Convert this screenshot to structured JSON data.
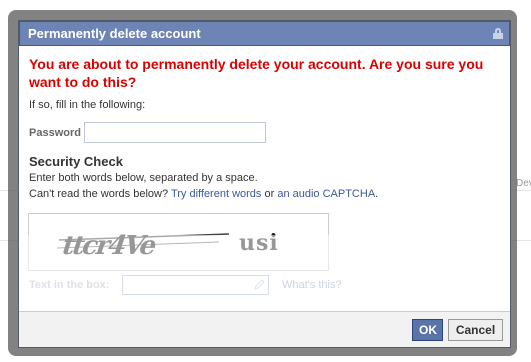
{
  "dialog": {
    "title": "Permanently delete account",
    "warning": "You are about to permanently delete your account. Are you sure you want to do this?",
    "fill_in_text": "If so, fill in the following:",
    "password": {
      "label": "Password",
      "value": ""
    },
    "security_check": {
      "title": "Security Check",
      "instruction": "Enter both words below, separated by a space.",
      "cant_read_prefix": "Can't read the words below?",
      "try_different_words": "Try different words",
      "or_text": "or",
      "audio_captcha": "an audio CAPTCHA",
      "period": ".",
      "captcha_words": [
        "ttcr4Ve",
        "usi"
      ]
    },
    "text_in_box": {
      "label": "Text in the box:",
      "value": ""
    },
    "whats_this": "What's this?",
    "buttons": {
      "ok": "OK",
      "cancel": "Cancel"
    }
  },
  "background": {
    "partial_word": "Dev"
  },
  "colors": {
    "title_bar": "#6d84b4",
    "warning_text": "#dd0000",
    "link": "#3b5998",
    "ok_button": "#5b74a8"
  }
}
